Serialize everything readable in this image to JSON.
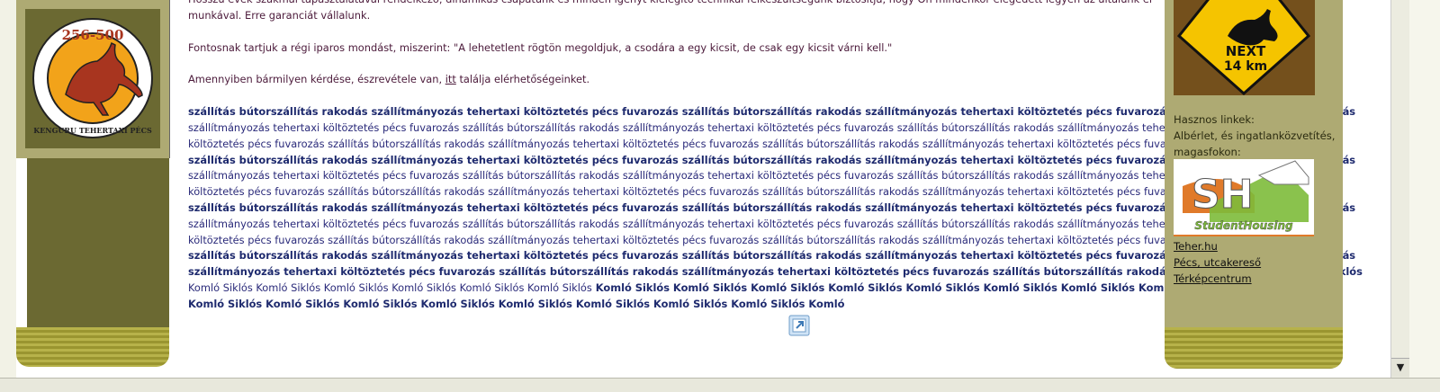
{
  "intro": {
    "line1": "Hosszú évek szakmai tapasztalatával rendelkező, dinamikus csapatunk és minden igényt kielégítő technikai felkészültségünk biztosítja, hogy Ön mindenkor elégedett legyen az általunk elvégzett",
    "line2": "munkával. Erre garanciát vállalunk.",
    "quote": "Fontosnak tartjuk a régi iparos mondást, miszerint: \"A lehetetlent rögtön megoldjuk, a csodára a egy kicsit, de csak egy kicsit várni kell.\"",
    "contact_prefix": "Amennyiben bármilyen kérdése, észrevétele van,",
    "contact_link": "itt",
    "contact_suffix": "találja elérhetőségeinket."
  },
  "keywords": [
    [
      {
        "t": "szállítás bútorszállítás rakodás szállítmányozás tehertaxi költöztetés pécs fuvarozás szállítás bútorszállítás rakodás szállítmányozás tehertaxi költöztetés pécs fuvarozás szállítás bútorszállítás rakodás",
        "b": true
      }
    ],
    [
      {
        "t": "szállítmányozás tehertaxi költöztetés pécs fuvarozás szállítás bútorszállítás rakodás szállítmányozás tehertaxi költöztetés pécs fuvarozás szállítás bútorszállítás rakodás szállítmányozás tehertaxi",
        "b": false
      }
    ],
    [
      {
        "t": "költöztetés pécs fuvarozás szállítás bútorszállítás rakodás szállítmányozás tehertaxi költöztetés pécs fuvarozás szállítás bútorszállítás rakodás szállítmányozás tehertaxi költöztetés pécs fuvarozás",
        "b": false
      }
    ],
    [
      {
        "t": "szállítás bútorszállítás rakodás szállítmányozás tehertaxi költöztetés pécs fuvarozás szállítás bútorszállítás rakodás szállítmányozás tehertaxi költöztetés pécs fuvarozás szállítás bútorszállítás rakodás",
        "b": true
      }
    ],
    [
      {
        "t": "szállítmányozás tehertaxi költöztetés pécs fuvarozás szállítás bútorszállítás rakodás szállítmányozás tehertaxi költöztetés pécs fuvarozás szállítás bútorszállítás rakodás szállítmányozás tehertaxi",
        "b": false
      }
    ],
    [
      {
        "t": "költöztetés pécs fuvarozás szállítás bútorszállítás rakodás szállítmányozás tehertaxi költöztetés pécs fuvarozás szállítás bútorszállítás rakodás szállítmányozás tehertaxi költöztetés pécs fuvarozás",
        "b": false
      }
    ],
    [
      {
        "t": "szállítás bútorszállítás rakodás szállítmányozás tehertaxi költöztetés pécs fuvarozás szállítás bútorszállítás rakodás szállítmányozás tehertaxi költöztetés pécs fuvarozás szállítás bútorszállítás rakodás",
        "b": true
      }
    ],
    [
      {
        "t": "szállítmányozás tehertaxi költöztetés pécs fuvarozás szállítás bútorszállítás rakodás szállítmányozás tehertaxi költöztetés pécs fuvarozás szállítás bútorszállítás rakodás szállítmányozás tehertaxi",
        "b": false
      }
    ],
    [
      {
        "t": "költöztetés pécs fuvarozás szállítás bútorszállítás rakodás szállítmányozás tehertaxi költöztetés pécs fuvarozás szállítás bútorszállítás rakodás szállítmányozás tehertaxi költöztetés pécs fuvarozás",
        "b": false
      }
    ],
    [
      {
        "t": "szállítás bútorszállítás rakodás szállítmányozás tehertaxi költöztetés pécs fuvarozás szállítás bútorszállítás rakodás szállítmányozás tehertaxi költöztetés pécs fuvarozás szállítás bútorszállítás rakodás",
        "b": true
      }
    ],
    [
      {
        "t": "szállítmányozás tehertaxi költöztetés pécs fuvarozás szállítás bútorszállítás rakodás szállítmányozás tehertaxi költöztetés pécs fuvarozás szállítás bútorszállítás rakodás szállítmányozás tehertaxi Siklós",
        "b": true
      }
    ],
    [
      {
        "t": "Komló Siklós Komló Siklós Komló Siklós Komló Siklós Komló Siklós Komló Siklós",
        "b": false
      },
      {
        "t": " Komló Siklós Komló Siklós Komló Siklós Komló Siklós Komló Siklós Komló Siklós Komló Siklós Komló Siklós",
        "b": true
      }
    ],
    [
      {
        "t": "Komló Siklós Komló Siklós Komló Siklós Komló Siklós Komló Siklós Komló Siklós Komló Siklós Komló Siklós Komló",
        "b": true
      }
    ]
  ],
  "useful_links": {
    "heading": "Hasznos linkek:",
    "desc": "Albérlet, és ingatlanközvetítés, magasfokon:",
    "sh_logo_text": "StudentHousing",
    "links": [
      "Teher.hu",
      "Pécs, utcakereső",
      "Térképcentrum"
    ]
  },
  "logo": {
    "number": "256-500",
    "text": "KENGURU TEHERTAXI PÉCS"
  },
  "sign": {
    "line1": "NEXT",
    "line2": "14 km"
  },
  "colors": {
    "olive_dark": "#6b6932",
    "olive_light": "#aeaa73",
    "stripe": "#b7b24a",
    "text": "#4b1a3a",
    "keyword": "#1e2a6e"
  },
  "icons": {
    "external_link": "external-link-icon",
    "scroll_down": "scroll-down-arrow-icon"
  }
}
